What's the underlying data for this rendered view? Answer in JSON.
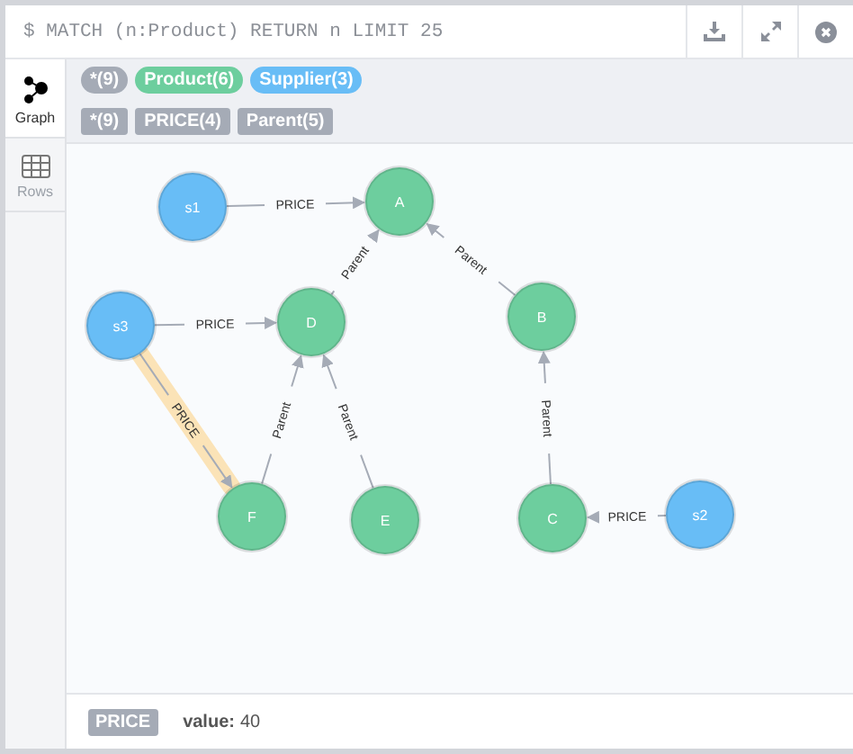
{
  "query_bar": {
    "query": "$ MATCH (n:Product) RETURN n LIMIT 25",
    "actions": [
      {
        "kind": "download"
      },
      {
        "kind": "expand"
      },
      {
        "kind": "close"
      }
    ]
  },
  "view_tabs": [
    {
      "label": "Graph",
      "kind": "graph",
      "selected": true
    },
    {
      "label": "Rows",
      "kind": "rows",
      "selected": false
    }
  ],
  "node_labels": [
    {
      "text": "*(9)",
      "color": "#a5abb6"
    },
    {
      "text": "Product(6)",
      "color": "#6dce9e"
    },
    {
      "text": "Supplier(3)",
      "color": "#68bdf6"
    }
  ],
  "relationship_types": [
    "*(9)",
    "PRICE(4)",
    "Parent(5)"
  ],
  "graph": {
    "nodes": [
      {
        "label": "s1",
        "color": "#68bdf6"
      },
      {
        "label": "A",
        "color": "#6dce9e"
      },
      {
        "label": "s3",
        "color": "#68bdf6"
      },
      {
        "label": "D",
        "color": "#6dce9e"
      },
      {
        "label": "B",
        "color": "#6dce9e"
      },
      {
        "label": "F",
        "color": "#6dce9e"
      },
      {
        "label": "E",
        "color": "#6dce9e"
      },
      {
        "label": "C",
        "color": "#6dce9e"
      },
      {
        "label": "s2",
        "color": "#68bdf6"
      }
    ],
    "edges": [
      {
        "label": "PRICE",
        "selected": false
      },
      {
        "label": "PRICE",
        "selected": false
      },
      {
        "label": "PRICE",
        "selected": true
      },
      {
        "label": "Parent",
        "selected": false
      },
      {
        "label": "Parent",
        "selected": false
      },
      {
        "label": "Parent",
        "selected": false
      },
      {
        "label": "Parent",
        "selected": false
      },
      {
        "label": "Parent",
        "selected": false
      },
      {
        "label": "PRICE",
        "selected": false
      }
    ]
  },
  "details": {
    "type": "PRICE",
    "key": "value:",
    "value": "40"
  }
}
